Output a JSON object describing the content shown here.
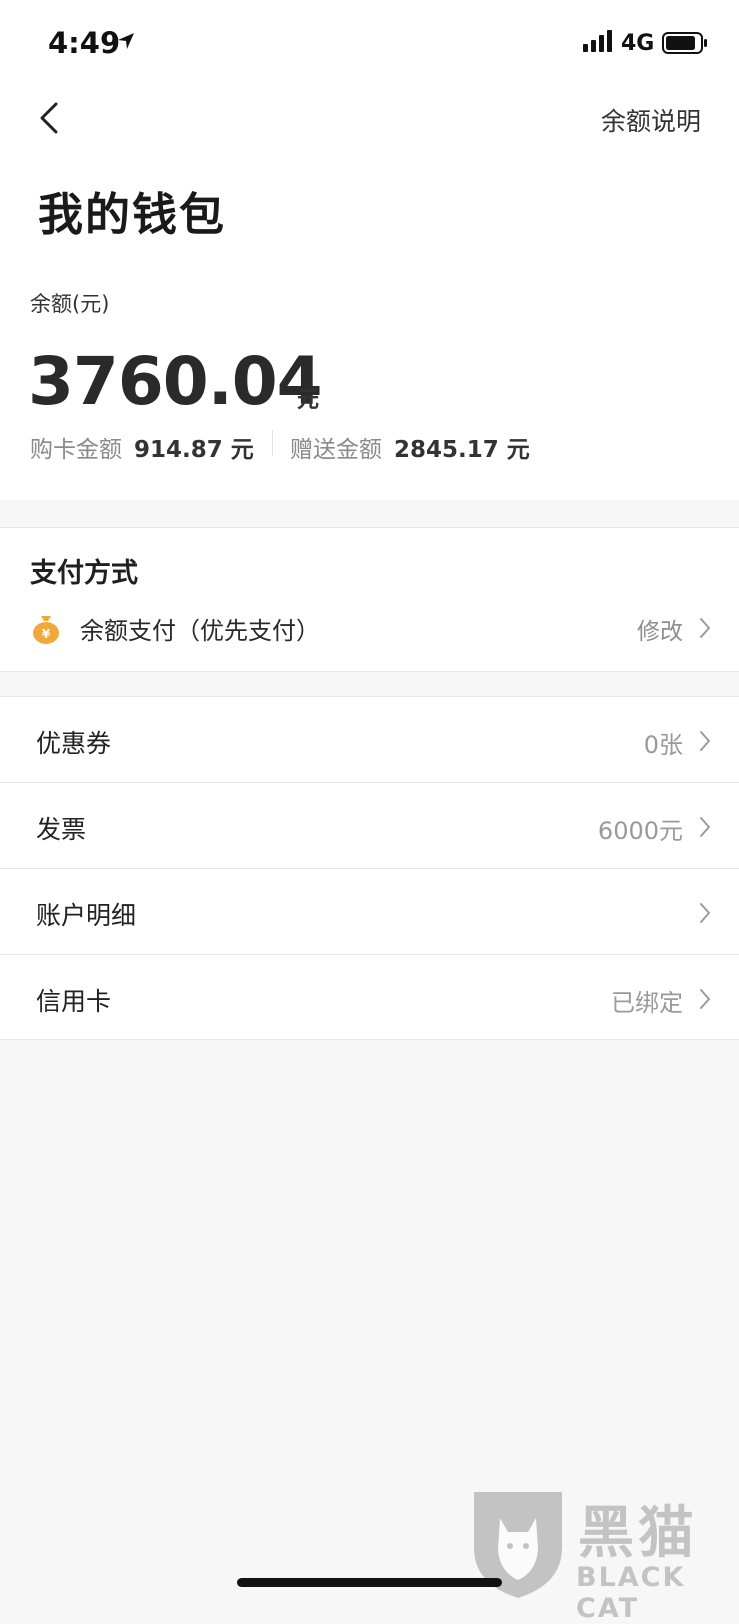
{
  "status_bar": {
    "time": "4:49",
    "network": "4G"
  },
  "nav": {
    "help_label": "余额说明"
  },
  "page": {
    "title": "我的钱包"
  },
  "balance": {
    "label": "余额(元)",
    "amount": "3760.04",
    "unit": "元",
    "purchased_label": "购卡金额",
    "purchased_value": "914.87 元",
    "gifted_label": "赠送金额",
    "gifted_value": "2845.17 元"
  },
  "payment": {
    "title": "支付方式",
    "method": "余额支付（优先支付）",
    "edit_label": "修改"
  },
  "menu": {
    "items": [
      {
        "label": "优惠券",
        "value": "0张"
      },
      {
        "label": "发票",
        "value": "6000元"
      },
      {
        "label": "账户明细",
        "value": ""
      },
      {
        "label": "信用卡",
        "value": "已绑定"
      }
    ]
  },
  "watermark": {
    "title": "黑猫",
    "subtitle": "BLACK CAT"
  },
  "colors": {
    "background": "#f8f7f8",
    "card": "#ffffff",
    "coin": "#f2a93b",
    "muted_text": "#9a9a9a"
  }
}
